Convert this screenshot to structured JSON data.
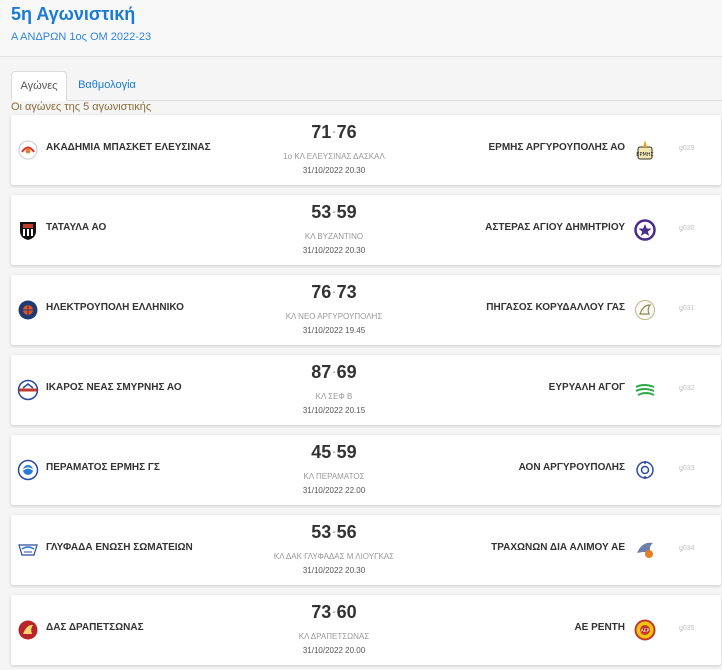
{
  "header": {
    "title": "5η Αγωνιστική",
    "subtitle": "Α ΑΝΔΡΩΝ 1ος ΟΜ 2022-23"
  },
  "tabs": [
    {
      "label": "Αγώνες",
      "active": true
    },
    {
      "label": "Βαθμολογία",
      "active": false
    }
  ],
  "caption": "Οι αγώνες της 5 αγωνιστικής",
  "colors": {
    "accent": "#1a7bd6",
    "caption": "#8a6d3b"
  },
  "games": [
    {
      "home": "ΑΚΑΔΗΜΙΑ ΜΠΑΣΚΕΤ ΕΛΕΥΣΙΝΑΣ",
      "home_score": "71",
      "away_score": "76",
      "away": "ΕΡΜΗΣ ΑΡΓΥΡΟΥΠΟΛΗΣ ΑΟ",
      "venue": "1ο ΚΛ ΕΛΕΥΣΙΝΑΣ ΔΑΣΚΑΛ",
      "datetime": "31/10/2022 20.30",
      "code": "g029",
      "home_logo": "akadimia-logo-icon",
      "away_logo": "ermis-logo-icon"
    },
    {
      "home": "ΤΑΤΑΥΛΑ ΑΟ",
      "home_score": "53",
      "away_score": "59",
      "away": "ΑΣΤΕΡΑΣ ΑΓΙΟΥ ΔΗΜΗΤΡΙΟΥ",
      "venue": "ΚΛ ΒΥΖΑΝΤΙΝΟ",
      "datetime": "31/10/2022 20.30",
      "code": "g030",
      "home_logo": "tatavla-logo-icon",
      "away_logo": "asteras-logo-icon"
    },
    {
      "home": "ΗΛΕΚΤΡΟΥΠΟΛΗ ΕΛΛΗΝΙΚΟ",
      "home_score": "76",
      "away_score": "73",
      "away": "ΠΗΓΑΣΟΣ ΚΟΡΥΔΑΛΛΟΥ ΓΑΣ",
      "venue": "ΚΛ ΝΕΟ ΑΡΓΥΡΟΥΠΟΛΗΣ",
      "datetime": "31/10/2022 19.45",
      "code": "g031",
      "home_logo": "ilektroupoli-logo-icon",
      "away_logo": "pigasos-logo-icon"
    },
    {
      "home": "ΙΚΑΡΟΣ ΝΕΑΣ ΣΜΥΡΝΗΣ ΑΟ",
      "home_score": "87",
      "away_score": "69",
      "away": "ΕΥΡΥΑΛΗ ΑΓΟΓ",
      "venue": "ΚΛ ΣΕΦ Β",
      "datetime": "31/10/2022 20.15",
      "code": "g032",
      "home_logo": "ikaros-logo-icon",
      "away_logo": "evryali-logo-icon"
    },
    {
      "home": "ΠΕΡΑΜΑΤΟΣ ΕΡΜΗΣ ΓΣ",
      "home_score": "45",
      "away_score": "59",
      "away": "ΑΟΝ ΑΡΓΥΡΟΥΠΟΛΗΣ",
      "venue": "ΚΛ ΠΕΡΑΜΑΤΟΣ",
      "datetime": "31/10/2022 22.00",
      "code": "g033",
      "home_logo": "perama-logo-icon",
      "away_logo": "aon-logo-icon"
    },
    {
      "home": "ΓΛΥΦΑΔΑ ΕΝΩΣΗ ΣΩΜΑΤΕΙΩΝ",
      "home_score": "53",
      "away_score": "56",
      "away": "ΤΡΑΧΩΝΩΝ ΔΙΑ ΑΛΙΜΟΥ ΑΕ",
      "venue": "ΚΛ ΔΑΚ ΓΛΥΦΑΔΑΣ Μ ΛΙΟΥΓΚΑΣ",
      "datetime": "31/10/2022 20.30",
      "code": "g034",
      "home_logo": "glyfada-logo-icon",
      "away_logo": "trachones-logo-icon"
    },
    {
      "home": "ΔΑΣ ΔΡΑΠΕΤΣΩΝΑΣ",
      "home_score": "73",
      "away_score": "60",
      "away": "ΑΕ ΡΕΝΤΗ",
      "venue": "ΚΛ ΔΡΑΠΕΤΣΩΝΑΣ",
      "datetime": "31/10/2022 20.00",
      "code": "g035",
      "home_logo": "drapetsona-logo-icon",
      "away_logo": "renti-logo-icon"
    }
  ]
}
